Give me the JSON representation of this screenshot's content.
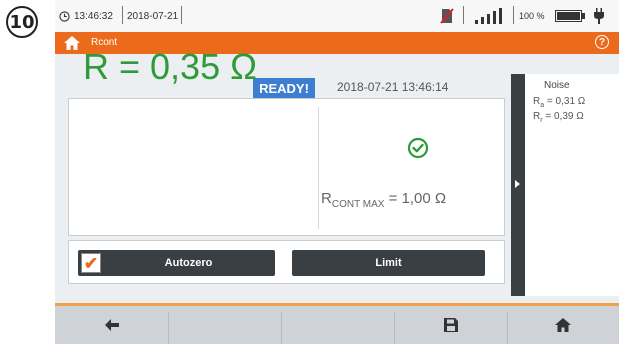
{
  "step_number": "10",
  "statusbar": {
    "time": "13:46:32",
    "date": "2018-07-21",
    "battery_text": "100 %"
  },
  "titlebar": {
    "title": "Rcont",
    "help_label": "?"
  },
  "measurement": {
    "status": "READY!",
    "datetime": "2018-07-21 13:46:14",
    "result_label": "R = ",
    "result_value": "0,35 Ω",
    "limit_label_main": "R",
    "limit_label_sub": "CONT MAX",
    "limit_value": " = 1,00 Ω"
  },
  "side_panel": {
    "title": "Noise",
    "lines": [
      {
        "sym": "R",
        "sub": "a",
        "value": " = 0,31 Ω"
      },
      {
        "sym": "R",
        "sub": "r",
        "value": " = 0,39 Ω"
      }
    ]
  },
  "buttons": {
    "autozero_label": "Autozero",
    "autozero_checked": true,
    "limit_label": "Limit"
  },
  "footer": {
    "icons": [
      "back-arrow-icon",
      "save-icon",
      "home-icon"
    ]
  },
  "colors": {
    "accent_orange": "#ec6a1c",
    "ready_blue": "#3d7ed0",
    "result_green": "#2f9a3a",
    "button_dark": "#3a3f44"
  }
}
